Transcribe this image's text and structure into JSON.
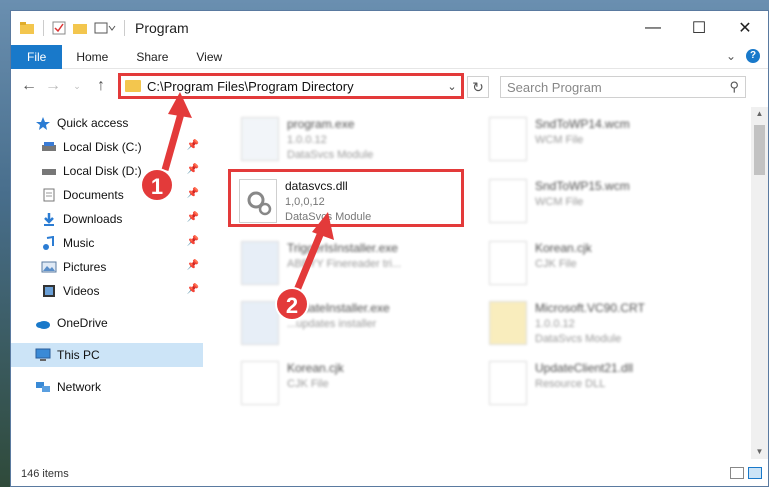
{
  "window": {
    "title": "Program",
    "controls": {
      "minimize": "—",
      "maximize": "☐",
      "close": "✕"
    }
  },
  "ribbon": {
    "tabs": [
      "File",
      "Home",
      "Share",
      "View"
    ],
    "help": "?"
  },
  "navbar": {
    "address": "C:\\Program Files\\Program Directory",
    "search_placeholder": "Search Program"
  },
  "sidebar": {
    "quick_access": "Quick access",
    "items": [
      {
        "label": "Local Disk (C:)",
        "icon": "drive-icon"
      },
      {
        "label": "Local Disk (D:)",
        "icon": "drive-icon"
      },
      {
        "label": "Documents",
        "icon": "documents-icon"
      },
      {
        "label": "Downloads",
        "icon": "downloads-icon"
      },
      {
        "label": "Music",
        "icon": "music-icon"
      },
      {
        "label": "Pictures",
        "icon": "pictures-icon"
      },
      {
        "label": "Videos",
        "icon": "videos-icon"
      }
    ],
    "onedrive": "OneDrive",
    "this_pc": "This PC",
    "network": "Network"
  },
  "files": [
    {
      "name": "program.exe",
      "line2": "1.0.0.12",
      "line3": "DataSvcs Module"
    },
    {
      "name": "SndToWP14.wcm",
      "line2": "WCM File",
      "line3": ""
    },
    {
      "name": "datasvcs.dll",
      "line2": "1,0,0,12",
      "line3": "DataSvcs Module"
    },
    {
      "name": "SndToWP15.wcm",
      "line2": "WCM File",
      "line3": ""
    },
    {
      "name": "TriggerIsInstaller.exe",
      "line2": "ABBYY Finereader tri...",
      "line3": ""
    },
    {
      "name": "Korean.cjk",
      "line2": "CJK File",
      "line3": ""
    },
    {
      "name": "UpdateInstaller.exe",
      "line2": "...updates installer",
      "line3": ""
    },
    {
      "name": "Microsoft.VC90.CRT",
      "line2": "1.0.0.12",
      "line3": "DataSvcs Module"
    },
    {
      "name": "Korean.cjk",
      "line2": "CJK File",
      "line3": ""
    },
    {
      "name": "UpdateClient21.dll",
      "line2": "Resource DLL",
      "line3": ""
    }
  ],
  "status": {
    "items": "146 items"
  },
  "markers": {
    "one": "1",
    "two": "2"
  },
  "colors": {
    "accent": "#1979ca",
    "highlight": "#e33a3a",
    "selected": "#cce4f7"
  }
}
